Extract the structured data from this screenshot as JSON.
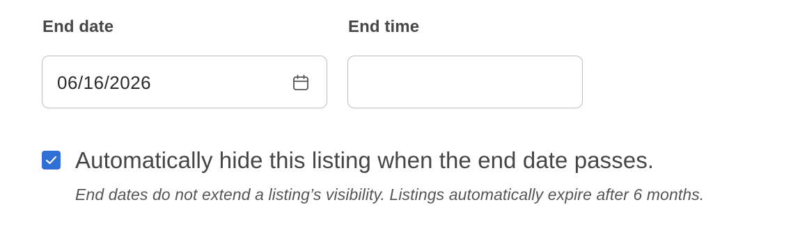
{
  "form": {
    "end_date": {
      "label": "End date",
      "value": "06/16/2026",
      "icon": "calendar-icon"
    },
    "end_time": {
      "label": "End time",
      "value": ""
    },
    "auto_hide": {
      "checked": true,
      "label": "Automatically hide this listing when the end date passes.",
      "help_text": "End dates do not extend a listing’s visibility. Listings automatically expire after 6 months."
    }
  },
  "colors": {
    "accent": "#2f6fd6",
    "border": "#bdbdbd",
    "label": "#474747"
  }
}
